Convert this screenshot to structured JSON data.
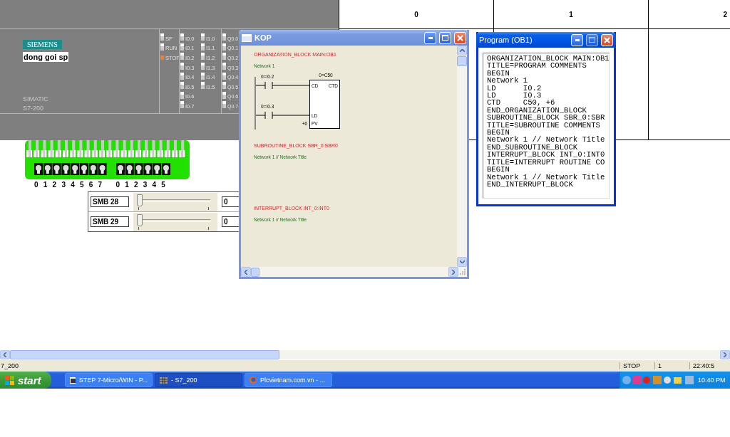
{
  "plc": {
    "brand": "SIEMENS",
    "name": "dong goi sp",
    "model_lines": [
      "SIMATIC",
      "S7-200"
    ],
    "status_leds": [
      {
        "label": "SF",
        "on": false
      },
      {
        "label": "RUN",
        "on": false
      },
      {
        "label": "STOP",
        "on": true
      }
    ],
    "inputs": [
      {
        "leds": [
          {
            "label": "I0.0",
            "on": false
          },
          {
            "label": "I0.1",
            "on": false
          },
          {
            "label": "I0.2",
            "on": false
          },
          {
            "label": "I0.3",
            "on": false
          },
          {
            "label": "I0.4",
            "on": false
          },
          {
            "label": "I0.5",
            "on": false
          },
          {
            "label": "I0.6",
            "on": false
          },
          {
            "label": "I0.7",
            "on": false
          }
        ]
      },
      {
        "leds": [
          {
            "label": "I1.0",
            "on": false
          },
          {
            "label": "I1.1",
            "on": false
          },
          {
            "label": "I1.2",
            "on": false
          },
          {
            "label": "I1.3",
            "on": false
          },
          {
            "label": "I1.4",
            "on": false
          },
          {
            "label": "I1.5",
            "on": false
          }
        ]
      }
    ],
    "outputs": [
      {
        "label": "Q0.0",
        "on": false
      },
      {
        "label": "Q0.1",
        "on": false
      },
      {
        "label": "Q0.2",
        "on": false
      },
      {
        "label": "Q0.3",
        "on": false
      },
      {
        "label": "Q0.4",
        "on": false
      },
      {
        "label": "Q0.5",
        "on": false
      },
      {
        "label": "Q0.6",
        "on": false
      },
      {
        "label": "Q0.7",
        "on": false
      }
    ]
  },
  "terminal": {
    "groups": [
      {
        "digits": [
          "0",
          "1",
          "2",
          "3",
          "4",
          "5",
          "6",
          "7"
        ]
      },
      {
        "digits": [
          "0",
          "1",
          "2",
          "3",
          "4",
          "5"
        ]
      }
    ]
  },
  "smb_rows": [
    {
      "label": "SMB 28",
      "level": 0,
      "value": "0"
    },
    {
      "label": "SMB 29",
      "level": 0,
      "value": "0"
    }
  ],
  "table": {
    "columns": [
      "0",
      "1",
      "2"
    ]
  },
  "kop_window": {
    "title": "KOP",
    "active": false,
    "blocks": [
      {
        "heading": "ORGANIZATION_BLOCK MAIN:OB1",
        "network": "Network 1",
        "ladder": {
          "contacts": [
            {
              "label": "0=I0.2",
              "pin": "CD"
            },
            {
              "label": "0=I0.3",
              "pin": "LD"
            }
          ],
          "counter": {
            "name": "0=C50",
            "type": "CTD",
            "preset_pin": "PV",
            "preset": "+6"
          }
        }
      },
      {
        "heading": "SUBROUTINE_BLOCK SBR_0:SBR0",
        "network": "Network 1 // Network Title"
      },
      {
        "heading": "INTERRUPT_BLOCK INT_0:INT0",
        "network": "Network 1 // Network Title"
      }
    ]
  },
  "program_window": {
    "title": "Program (OB1)",
    "active": true,
    "lines": [
      "ORGANIZATION_BLOCK MAIN:OB1",
      "TITLE=PROGRAM COMMENTS",
      "BEGIN",
      "Network 1",
      "LD      I0.2",
      "LD      I0.3",
      "CTD     C50, +6",
      "END_ORGANIZATION_BLOCK",
      "SUBROUTINE_BLOCK SBR_0:SBR",
      "TITLE=SUBROUTINE COMMENTS",
      "BEGIN",
      "Network 1 // Network Title",
      "END_SUBROUTINE_BLOCK",
      "INTERRUPT_BLOCK INT_0:INT0",
      "TITLE=INTERRUPT ROUTINE CO",
      "BEGIN",
      "Network 1 // Network Title",
      "END_INTERRUPT_BLOCK"
    ]
  },
  "status_bar": {
    "left": "7_200",
    "fields": [
      "STOP",
      "1",
      "22:40:5"
    ]
  },
  "taskbar": {
    "start": "start",
    "tasks": [
      {
        "label": "STEP 7-Micro/WIN - P...",
        "selected": false,
        "kind": "window"
      },
      {
        "label": "- S7_200",
        "selected": true,
        "kind": "grid"
      },
      {
        "label": "Plcvietnam.com.vn - ...",
        "selected": false,
        "kind": "globe"
      }
    ],
    "clock": "10:40 PM"
  }
}
